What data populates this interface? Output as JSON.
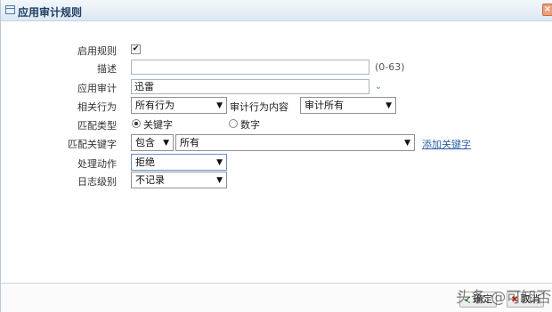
{
  "window": {
    "title": "应用审计规则",
    "close_icon": "close-icon"
  },
  "form": {
    "enable_rule": {
      "label": "启用规则",
      "checked": true,
      "check_glyph": "✔"
    },
    "description": {
      "label": "描述",
      "value": "",
      "hint": "(0-63)"
    },
    "app_audit": {
      "label": "应用审计",
      "value": "迅雷"
    },
    "related_behavior": {
      "label": "相关行为",
      "value": "所有行为",
      "content_label": "审计行为内容",
      "content_value": "审计所有"
    },
    "match_type": {
      "label": "匹配类型",
      "options": [
        "关键字",
        "数字"
      ],
      "selected": "关键字"
    },
    "match_keyword": {
      "label": "匹配关键字",
      "mode": "包含",
      "value": "所有",
      "add_link": "添加关键字"
    },
    "action": {
      "label": "处理动作",
      "value": "拒绝"
    },
    "log_level": {
      "label": "日志级别",
      "value": "不记录"
    }
  },
  "footer": {
    "ok_label": "确定",
    "cancel_label": "取消"
  },
  "watermark": "头条 @可知否",
  "colors": {
    "accent": "#2d62a8",
    "title_text": "#1f3f66",
    "close_bg": "#e8a07a"
  }
}
